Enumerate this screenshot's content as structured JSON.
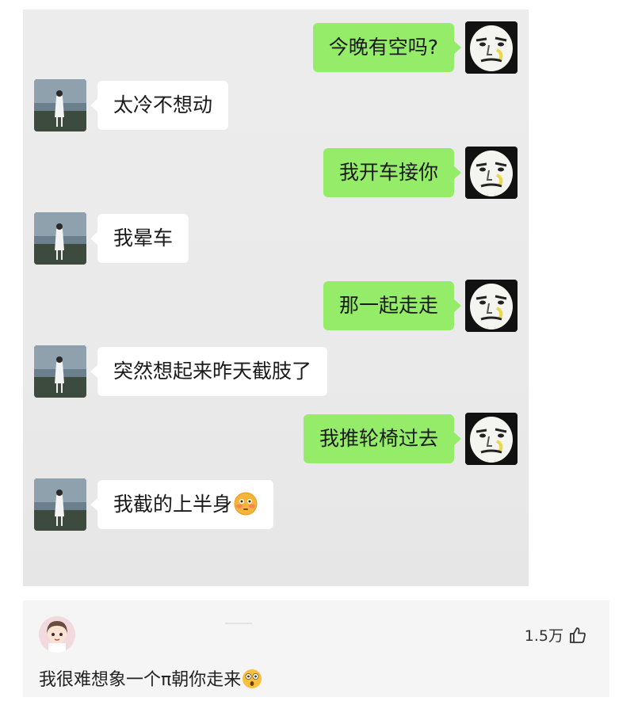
{
  "chat": {
    "messages": [
      {
        "side": "right",
        "text": "今晚有空吗?"
      },
      {
        "side": "left",
        "text": "太冷不想动"
      },
      {
        "side": "right",
        "text": "我开车接你"
      },
      {
        "side": "left",
        "text": "我晕车"
      },
      {
        "side": "right",
        "text": "那一起走走"
      },
      {
        "side": "left",
        "text": "突然想起来昨天截肢了"
      },
      {
        "side": "right",
        "text": "我推轮椅过去"
      },
      {
        "side": "left",
        "text": "我截的上半身",
        "emoji": "flushed-face-emoji"
      }
    ]
  },
  "comment": {
    "like_count": "1.5万",
    "text": "我很难想象一个π朝你走来",
    "emoji": "astonished-face-emoji"
  },
  "colors": {
    "sent_bubble": "#95ec69",
    "received_bubble": "#ffffff",
    "chat_background": "#ebebeb",
    "comment_background": "#f5f5f5"
  }
}
